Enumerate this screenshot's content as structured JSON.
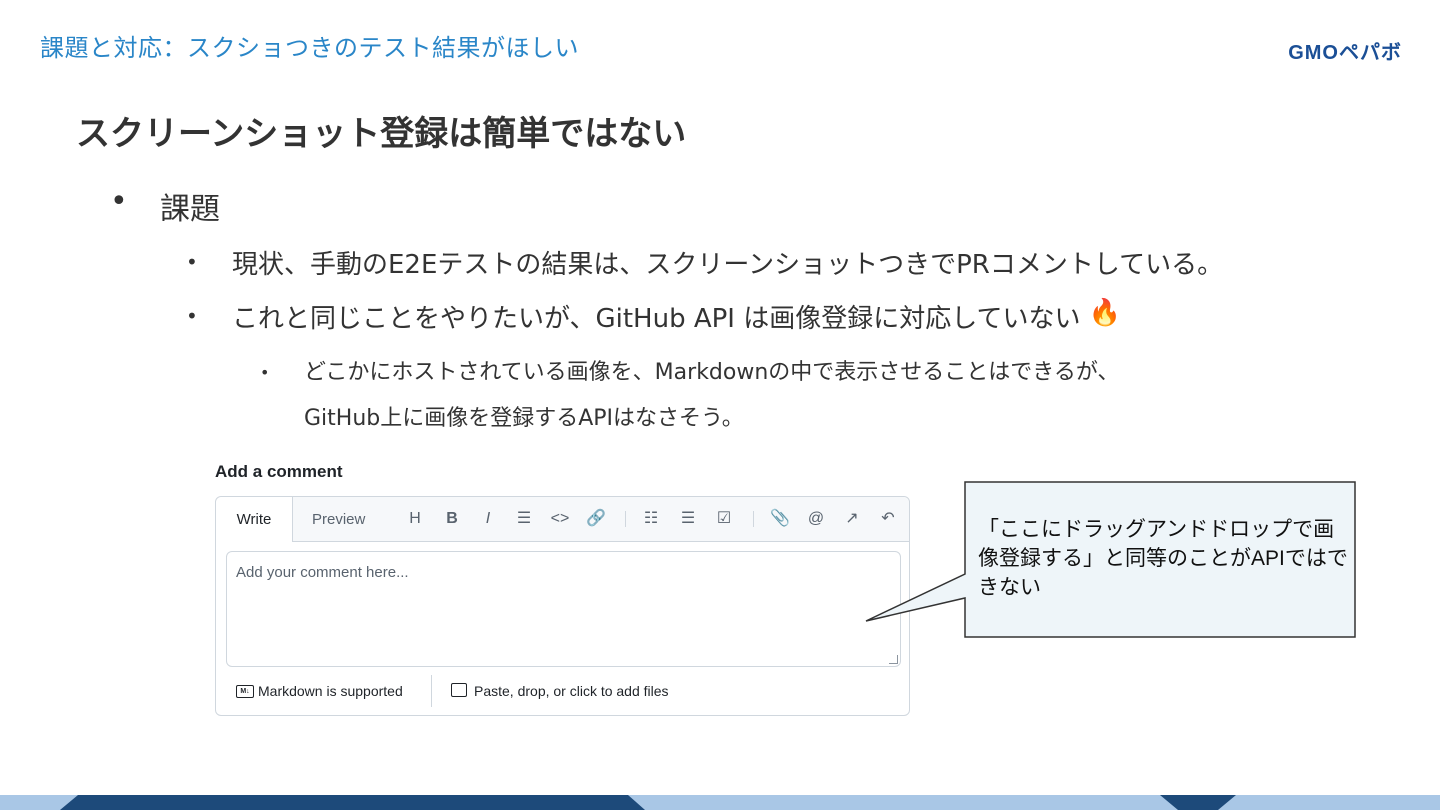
{
  "header": {
    "section_title": "課題と対応：スクショつきのテスト結果がほしい",
    "logo_text": "GMOペパボ"
  },
  "slide": {
    "title": "スクリーンショット登録は簡単ではない",
    "bullet1": "課題",
    "bullet2a": "現状、手動のE2Eテストの結果は、スクリーンショットつきでPRコメントしている。",
    "bullet2b": "これと同じことをやりたいが、GitHub API は画像登録に対応していない",
    "bullet2b_emoji": "🔥",
    "bullet3_line1": "どこかにホストされている画像を、Markdownの中で表示させることはできるが、",
    "bullet3_line2": "GitHub上に画像を登録するAPIはなさそう。",
    "bullet_dot": "•"
  },
  "comment_box": {
    "title": "Add a comment",
    "tab_write": "Write",
    "tab_preview": "Preview",
    "toolbar": {
      "heading": "H",
      "bold": "B",
      "italic": "I",
      "quote": "☰",
      "code": "<>",
      "link": "🔗",
      "ordered_list": "☷",
      "unordered_list": "☰",
      "task_list": "☑",
      "attach": "📎",
      "mention": "@",
      "reference": "↗",
      "undo": "↶"
    },
    "placeholder": "Add your comment here...",
    "markdown_badge": "M↓",
    "markdown_label": "Markdown is supported",
    "paste_label": "Paste, drop, or click to add files"
  },
  "callout": {
    "text": "「ここにドラッグアンドドロップで画像登録する」と同等のことがAPIではできない"
  },
  "colors": {
    "section_title": "#2a86c8",
    "footer_dark": "#1d4a7a",
    "footer_light": "#a9c7e6",
    "callout_fill": "#eef5f9"
  }
}
